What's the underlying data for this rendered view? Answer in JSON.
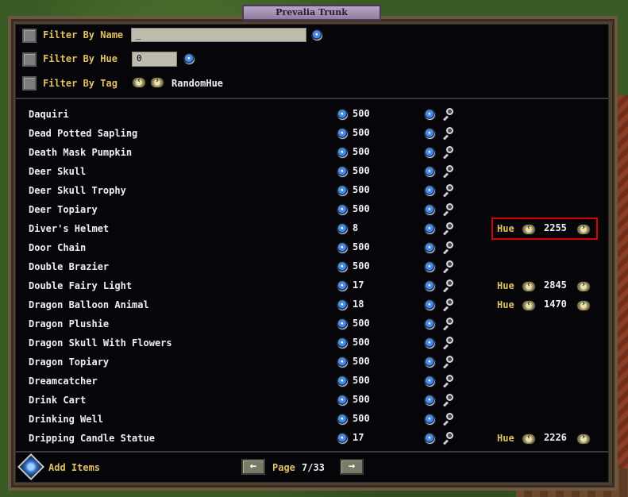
{
  "window": {
    "title": "Prevalia Trunk"
  },
  "filters": {
    "name": {
      "label": "Filter By Name",
      "value": "_"
    },
    "hue": {
      "label": "Filter By Hue",
      "value": "0"
    },
    "tag": {
      "label": "Filter By Tag",
      "value": "RandomHue"
    }
  },
  "items": [
    {
      "name": "Daquiri",
      "qty": "500"
    },
    {
      "name": "Dead Potted Sapling",
      "qty": "500"
    },
    {
      "name": "Death Mask Pumpkin",
      "qty": "500"
    },
    {
      "name": "Deer Skull",
      "qty": "500"
    },
    {
      "name": "Deer Skull Trophy",
      "qty": "500"
    },
    {
      "name": "Deer Topiary",
      "qty": "500"
    },
    {
      "name": "Diver's Helmet",
      "qty": "8",
      "hue_label": "Hue",
      "hue": "2255"
    },
    {
      "name": "Door Chain",
      "qty": "500"
    },
    {
      "name": "Double Brazier",
      "qty": "500"
    },
    {
      "name": "Double Fairy Light",
      "qty": "17",
      "hue_label": "Hue",
      "hue": "2845"
    },
    {
      "name": "Dragon Balloon Animal",
      "qty": "18",
      "hue_label": "Hue",
      "hue": "1470"
    },
    {
      "name": "Dragon Plushie",
      "qty": "500"
    },
    {
      "name": "Dragon Skull With Flowers",
      "qty": "500"
    },
    {
      "name": "Dragon Topiary",
      "qty": "500"
    },
    {
      "name": "Dreamcatcher",
      "qty": "500"
    },
    {
      "name": "Drink Cart",
      "qty": "500"
    },
    {
      "name": "Drinking Well",
      "qty": "500"
    },
    {
      "name": "Dripping Candle Statue",
      "qty": "17",
      "hue_label": "Hue",
      "hue": "2226"
    }
  ],
  "footer": {
    "add_label": "Add Items",
    "page_label": "Page",
    "page_value": "7/33"
  }
}
